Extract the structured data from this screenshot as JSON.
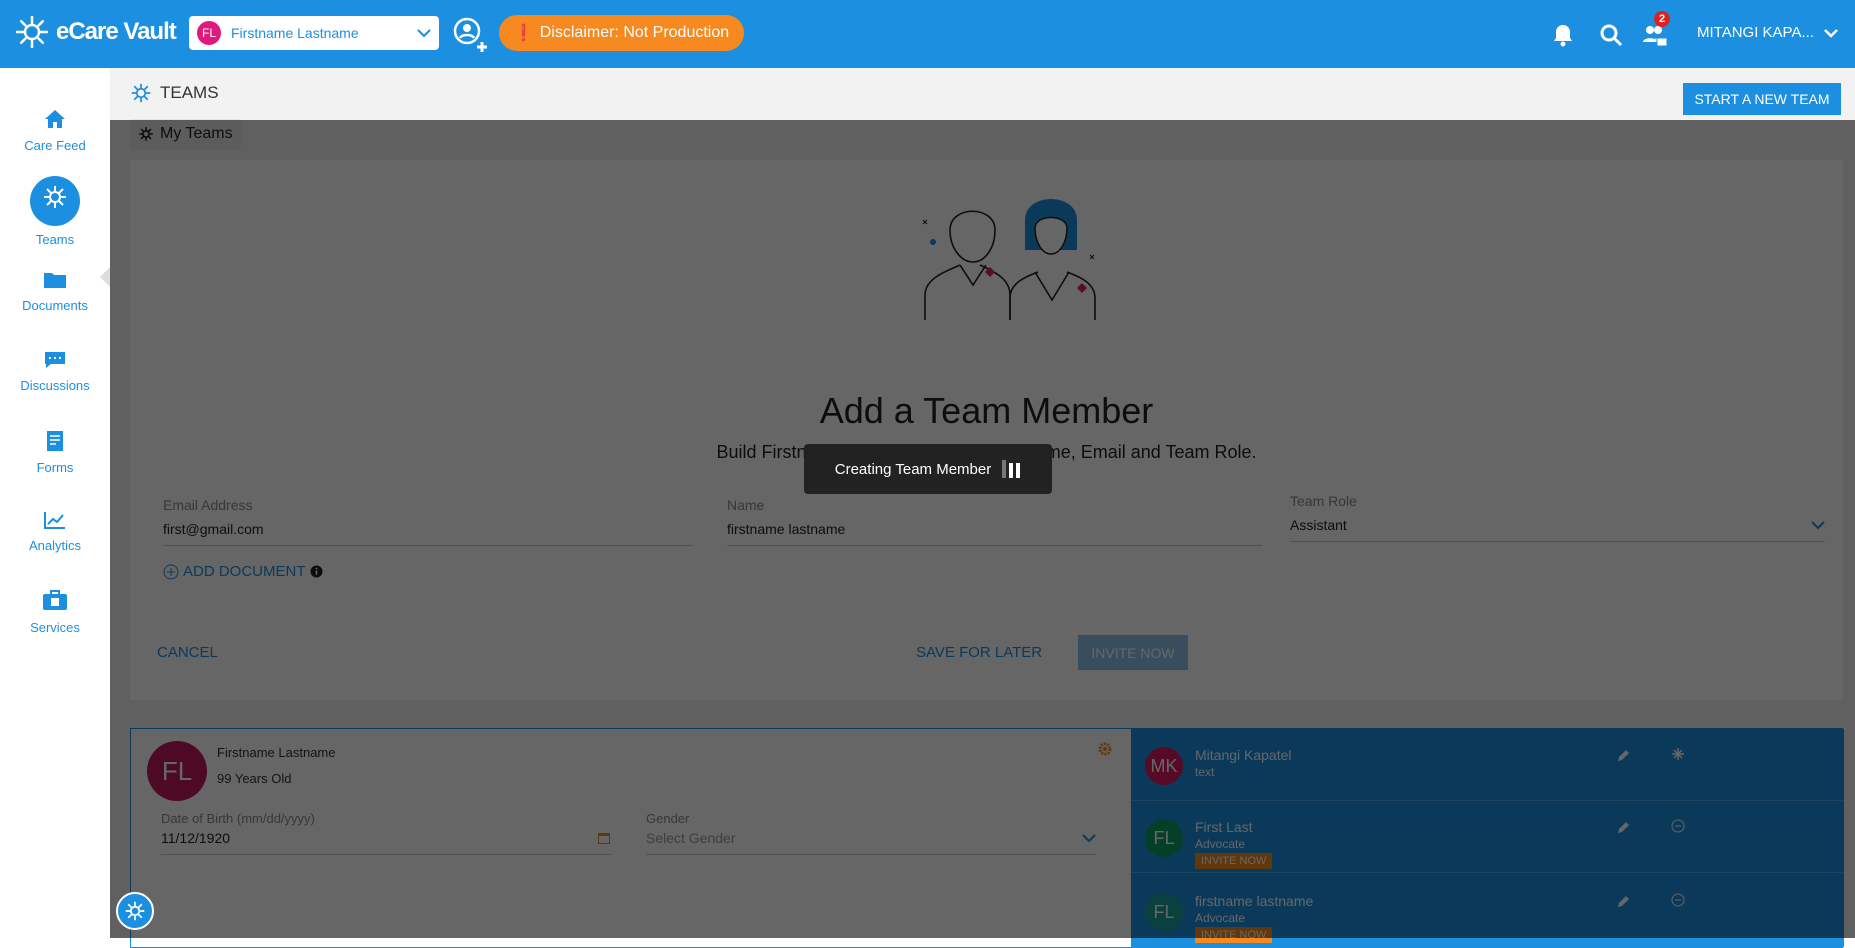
{
  "app": {
    "name": "eCare Vault"
  },
  "header": {
    "selected_person": "Firstname Lastname",
    "selected_person_initials": "FL",
    "disclaimer": "Disclaimer: Not Production",
    "notification_badge": "2",
    "user_name": "MITANGI KAPA..."
  },
  "sidebar": {
    "items": [
      {
        "label": "Care Feed",
        "icon": "home-icon"
      },
      {
        "label": "Teams",
        "icon": "teams-icon",
        "active": true
      },
      {
        "label": "Documents",
        "icon": "folder-icon"
      },
      {
        "label": "Discussions",
        "icon": "chat-icon"
      },
      {
        "label": "Forms",
        "icon": "form-icon"
      },
      {
        "label": "Analytics",
        "icon": "chart-icon"
      },
      {
        "label": "Services",
        "icon": "briefcase-icon"
      }
    ]
  },
  "page": {
    "title": "TEAMS",
    "start_team_label": "START A NEW TEAM",
    "my_teams_label": "My Teams"
  },
  "form": {
    "title": "Add a Team Member",
    "subtitle": "Build Firstname's Team by including a Name, Email and Team Role.",
    "email_label": "Email Address",
    "email_value": "first@gmail.com",
    "name_label": "Name",
    "name_value": "firstname lastname",
    "role_label": "Team Role",
    "role_value": "Assistant",
    "add_document_label": "ADD DOCUMENT",
    "cancel_label": "CANCEL",
    "save_later_label": "SAVE FOR LATER",
    "invite_label": "INVITE NOW"
  },
  "toast": {
    "text": "Creating Team Member"
  },
  "member_card": {
    "initials": "FL",
    "name": "Firstname Lastname",
    "age": "99 Years Old",
    "dob_label": "Date of Birth (mm/dd/yyyy)",
    "dob_value": "11/12/1920",
    "gender_label": "Gender",
    "gender_placeholder": "Select Gender",
    "members": [
      {
        "initials": "MK",
        "name": "Mitangi Kapatel",
        "role": "text",
        "color": "#d81b60",
        "invite": ""
      },
      {
        "initials": "FL",
        "name": "First Last",
        "role": "Advocate",
        "color": "#0a9e61",
        "invite": "INVITE NOW"
      },
      {
        "initials": "FL",
        "name": "firstname lastname",
        "role": "Advocate",
        "color": "#1aa39b",
        "invite": "INVITE NOW"
      }
    ]
  },
  "colors": {
    "brand": "#1d8fe1",
    "accent": "#f6891f"
  }
}
